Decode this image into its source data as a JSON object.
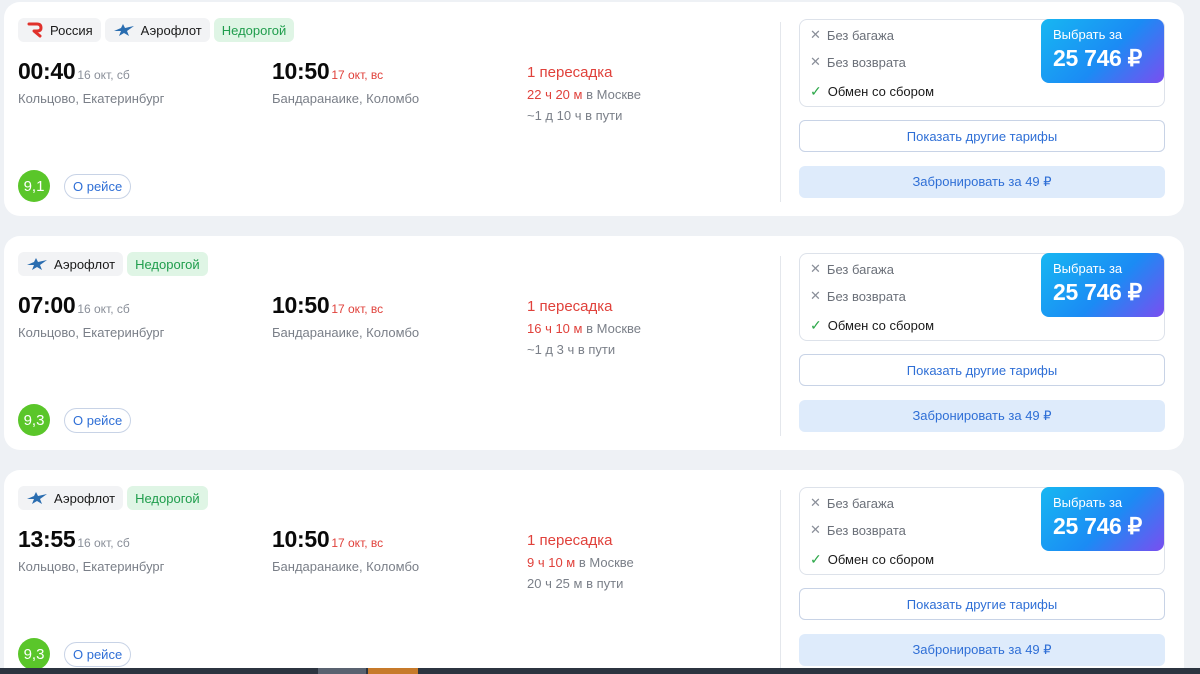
{
  "common": {
    "transfer": "1 пересадка",
    "in_moscow": "в Москве",
    "no_baggage": "Без багажа",
    "no_refund": "Без возврата",
    "exchange_fee": "Обмен со сбором",
    "select_for": "Выбрать за",
    "price": "25 746 ₽",
    "other_tariffs": "Показать другие тарифы",
    "book_for": "Забронировать за 49 ₽",
    "about_flight": "О рейсе",
    "cheap_badge": "Недорогой"
  },
  "colors": {
    "accent": "#2f6fd6",
    "red": "#e0413b",
    "green": "#5ac62a",
    "cheap_bg": "#dff5e5"
  },
  "flights": [
    {
      "airlines": [
        "Россия",
        "Аэрофлот"
      ],
      "dep_time": "00:40",
      "dep_date": "16 окт, сб",
      "dep_place": "Кольцово, Екатеринбург",
      "arr_time": "10:50",
      "arr_date": "17 окт, вс",
      "arr_place": "Бандаранаике, Коломбо",
      "wait": "22 ч 20 м",
      "duration": "~1 д 10 ч в пути",
      "rating": "9,1"
    },
    {
      "airlines": [
        "Аэрофлот"
      ],
      "dep_time": "07:00",
      "dep_date": "16 окт, сб",
      "dep_place": "Кольцово, Екатеринбург",
      "arr_time": "10:50",
      "arr_date": "17 окт, вс",
      "arr_place": "Бандаранаике, Коломбо",
      "wait": "16 ч 10 м",
      "duration": "~1 д 3 ч в пути",
      "rating": "9,3"
    },
    {
      "airlines": [
        "Аэрофлот"
      ],
      "dep_time": "13:55",
      "dep_date": "16 окт, сб",
      "dep_place": "Кольцово, Екатеринбург",
      "arr_time": "10:50",
      "arr_date": "17 окт, вс",
      "arr_place": "Бандаранаике, Коломбо",
      "wait": "9 ч 10 м",
      "duration": "20 ч 25 м в пути",
      "rating": "9,3"
    }
  ]
}
